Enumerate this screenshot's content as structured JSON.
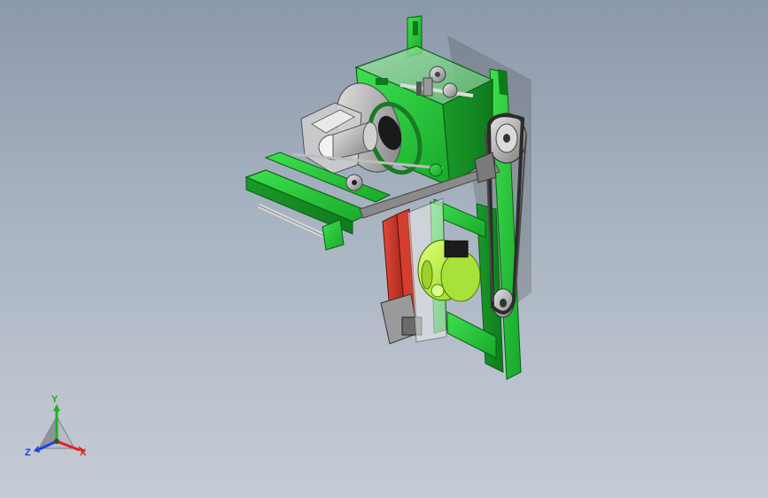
{
  "viewport": {
    "background_top": "#8c99ab",
    "background_bottom": "#c6ccd5"
  },
  "model": {
    "frame_color": "#27c93a",
    "frame_shadow": "#12801f",
    "motor_color": "#b8f03c",
    "belt_color": "#3a3a3a",
    "belt_guard_color": "#c0392b"
  },
  "triad": {
    "x_label": "X",
    "y_label": "Y",
    "z_label": "Z",
    "x_color": "#e02020",
    "y_color": "#20b020",
    "z_color": "#2040e0"
  }
}
